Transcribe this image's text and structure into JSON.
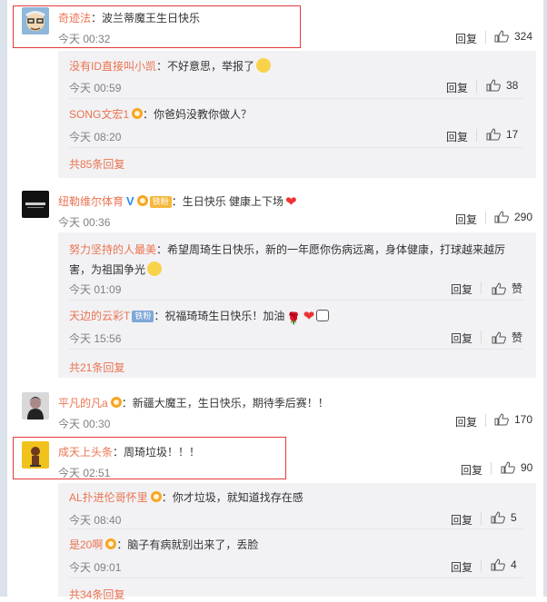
{
  "comments": [
    {
      "user": "奇迹法",
      "text": "：波兰蒂魔王生日快乐",
      "time": "今天 00:32",
      "reply": "回复",
      "likes": "324",
      "avatar": "cartoon-avatar"
    },
    {
      "user": "纽勒维尔体育",
      "text": "：生日快乐 健康上下场",
      "time": "今天 00:36",
      "reply": "回复",
      "likes": "290",
      "avatar": "black-logo-avatar",
      "badge_text": "铁粉"
    },
    {
      "user": "平凡的凡a",
      "text": "：新疆大魔王，生日快乐，期待季后赛！！",
      "time": "今天 00:30",
      "reply": "回复",
      "likes": "170",
      "avatar": "dark-portrait-avatar"
    },
    {
      "user": "成天上头条",
      "text": "：周琦垃圾！！！",
      "time": "今天 02:51",
      "reply": "回复",
      "likes": "90",
      "avatar": "yellow-cartoon-avatar"
    }
  ],
  "replies_group_1": [
    {
      "user": "没有ID直接叫小凯",
      "text": "：不好意思，举报了",
      "time": "今天 00:59",
      "reply": "回复",
      "likes": "38"
    },
    {
      "user": "SONG文宏1",
      "text": "：你爸妈没教你做人？",
      "time": "今天 08:20",
      "reply": "回复",
      "likes": "17"
    }
  ],
  "more_1": "共85条回复",
  "replies_group_2": [
    {
      "user": "努力坚持的人最美",
      "text_line1": "：希望周琦生日快乐，新的一年愿你伤病远离，身体健康，打球越来越厉",
      "text_line2": "害，为祖国争光",
      "time": "今天 01:09",
      "reply": "回复",
      "likes": "赞"
    },
    {
      "user": "天边的云彩T",
      "badge_text": "铁粉",
      "text": "：祝福琦琦生日快乐！加油",
      "time": "今天 15:56",
      "reply": "回复",
      "likes": "赞"
    }
  ],
  "more_2": "共21条回复",
  "replies_group_4": [
    {
      "user": "AL扑进伦哥怀里",
      "text": "：你才垃圾，就知道找存在感",
      "time": "今天 08:40",
      "reply": "回复",
      "likes": "5"
    },
    {
      "user": "是20啊",
      "text": "：脑子有病就别出来了，丢脸",
      "time": "今天 09:01",
      "reply": "回复",
      "likes": "4"
    }
  ],
  "more_4": "共34条回复",
  "colors": {
    "username": "#eb7350",
    "highlight_border": "#e33b3b",
    "reply_bg": "#f2f2f5",
    "meta_text": "#808080"
  }
}
